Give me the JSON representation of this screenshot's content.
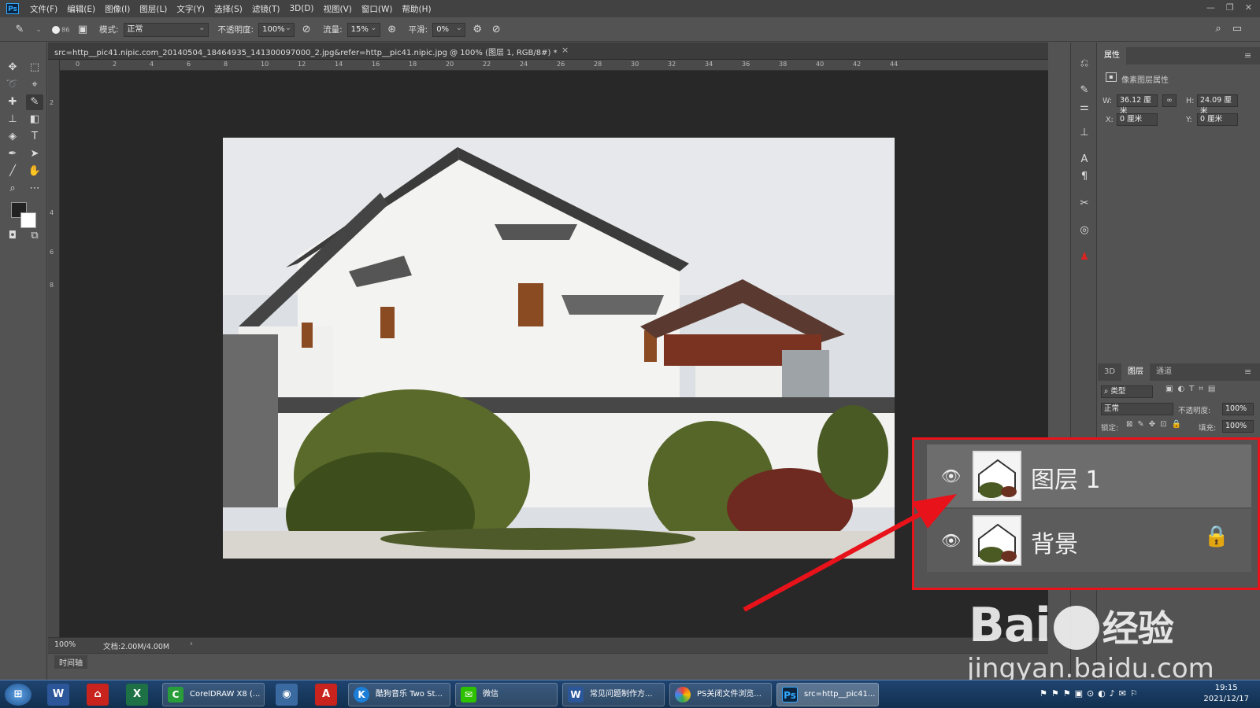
{
  "menubar": {
    "app_logo": "Ps",
    "items": [
      "文件(F)",
      "编辑(E)",
      "图像(I)",
      "图层(L)",
      "文字(Y)",
      "选择(S)",
      "滤镜(T)",
      "3D(D)",
      "视图(V)",
      "窗口(W)",
      "帮助(H)"
    ]
  },
  "options": {
    "mode_label": "模式:",
    "mode_value": "正常",
    "opacity_label": "不透明度:",
    "opacity_value": "100%",
    "flow_label": "流量:",
    "flow_value": "15%",
    "smooth_label": "平滑:",
    "smooth_value": "0%",
    "brush_size": "86"
  },
  "document": {
    "tab_title": "src=http__pic41.nipic.com_20140504_18464935_141300097000_2.jpg&refer=http__pic41.nipic.jpg @ 100% (图层 1, RGB/8#) *",
    "zoom": "100%",
    "doc_size": "文档:2.00M/4.00M",
    "ruler_h": [
      "0",
      "2",
      "4",
      "6",
      "8",
      "10",
      "12",
      "14",
      "16",
      "18",
      "20",
      "22",
      "24",
      "26",
      "28",
      "30",
      "32",
      "34",
      "36",
      "38",
      "40",
      "42",
      "44"
    ]
  },
  "timeline": {
    "label": "时间轴"
  },
  "properties": {
    "tab": "属性",
    "title": "像素图层属性",
    "w_label": "W:",
    "w_value": "36.12 厘米",
    "h_label": "H:",
    "h_value": "24.09 厘米",
    "x_label": "X:",
    "x_value": "0 厘米",
    "y_label": "Y:",
    "y_value": "0 厘米"
  },
  "layers": {
    "tabs": [
      "3D",
      "图层",
      "通道"
    ],
    "filter": "类型",
    "blend": "正常",
    "opacity_label": "不透明度:",
    "opacity": "100%",
    "lock_label": "锁定:",
    "fill_label": "填充:",
    "fill": "100%",
    "items": [
      {
        "name": "图层 1",
        "visible": true,
        "locked": false,
        "selected": true
      },
      {
        "name": "背景",
        "visible": true,
        "locked": true,
        "selected": false
      }
    ]
  },
  "watermark": {
    "brand": "Bai",
    "brand_cn": "经验",
    "url": "jingyan.baidu.com"
  },
  "taskbar": {
    "items": [
      "CorelDRAW X8 (...",
      "酷狗音乐 Two St...",
      "微信",
      "常见问题制作方...",
      "PS关闭文件浏览...",
      "src=http__pic41..."
    ],
    "time": "19:15",
    "date": "2021/12/17"
  },
  "colors": {
    "highlight": "#e8121a",
    "panel_bg": "#535353",
    "canvas_bg": "#282828"
  }
}
